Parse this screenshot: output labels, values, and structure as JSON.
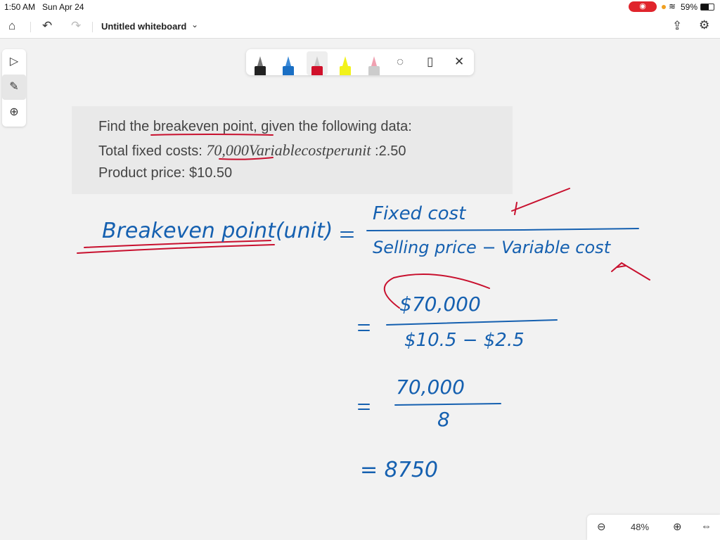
{
  "status": {
    "time": "1:50 AM",
    "date": "Sun Apr 24",
    "battery": "59%",
    "battery_level": 0.59,
    "record_color": "#e0242c"
  },
  "topbar": {
    "title": "Untitled whiteboard",
    "icons": [
      "home-icon",
      "undo-icon",
      "redo-icon",
      "chevron-down-icon",
      "share-icon",
      "gear-icon"
    ]
  },
  "sidebar": {
    "items": [
      "select-icon",
      "pen-icon",
      "add-icon"
    ]
  },
  "toolbox": {
    "pens": [
      {
        "name": "black-pen",
        "color": "#222222"
      },
      {
        "name": "blue-pen",
        "color": "#1a6fc4"
      },
      {
        "name": "red-pen",
        "color": "#d0102a"
      },
      {
        "name": "yellow-highlighter",
        "color": "#f2f21a"
      },
      {
        "name": "eraser",
        "color": "#f0a0b0"
      }
    ]
  },
  "question": {
    "line1": "Find the breakeven point, given the following data:",
    "line2_a": "Total fixed costs: ",
    "line2_math": "70,000Variablecostperunit",
    "line2_b": " :2.50",
    "line3": "Product price: $10.50"
  },
  "ink": {
    "color_blue": "#1560b0",
    "color_red": "#c8102e",
    "label": "Breakeven point(unit)",
    "eq": "=",
    "numerator": "Fixed cost",
    "denominator": "Selling price − Variable cost",
    "step1_num": "$70,000",
    "step1_den": "$10.5 − $2.5",
    "step2_num": "70,000",
    "step2_den": "8",
    "result": "= 8750"
  },
  "zoom": {
    "level": "48%"
  }
}
